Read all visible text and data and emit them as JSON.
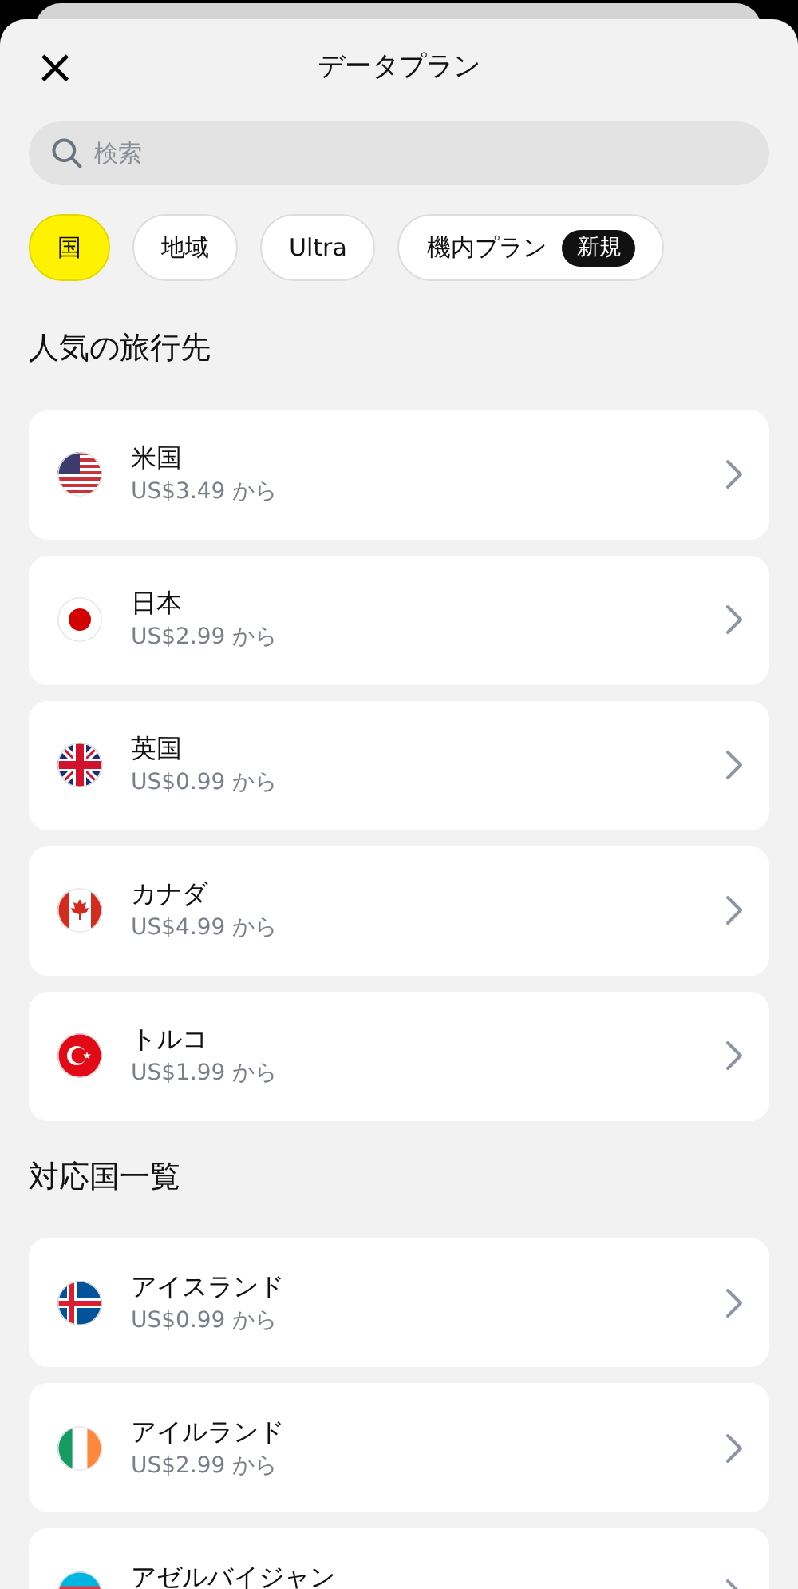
{
  "header": {
    "close": "×",
    "title": "データプラン"
  },
  "search": {
    "placeholder": "検索"
  },
  "chips": [
    {
      "label": "国",
      "selected": true
    },
    {
      "label": "地域",
      "selected": false
    },
    {
      "label": "Ultra",
      "selected": false
    },
    {
      "label": "機内プラン",
      "selected": false,
      "badge": "新規"
    }
  ],
  "sections": [
    {
      "heading": "人気の旅行先",
      "items": [
        {
          "kind": "us",
          "name": "米国",
          "price": "US$3.49 から"
        },
        {
          "kind": "jp",
          "name": "日本",
          "price": "US$2.99 から"
        },
        {
          "kind": "gb",
          "name": "英国",
          "price": "US$0.99 から"
        },
        {
          "kind": "ca",
          "name": "カナダ",
          "price": "US$4.99 から"
        },
        {
          "kind": "tr",
          "name": "トルコ",
          "price": "US$1.99 から"
        }
      ]
    },
    {
      "heading": "対応国一覧",
      "items": [
        {
          "kind": "is",
          "name": "アイスランド",
          "price": "US$0.99 から"
        },
        {
          "kind": "ie",
          "name": "アイルランド",
          "price": "US$2.99 から"
        },
        {
          "kind": "az",
          "name": "アゼルバイジャン"
        }
      ]
    }
  ]
}
